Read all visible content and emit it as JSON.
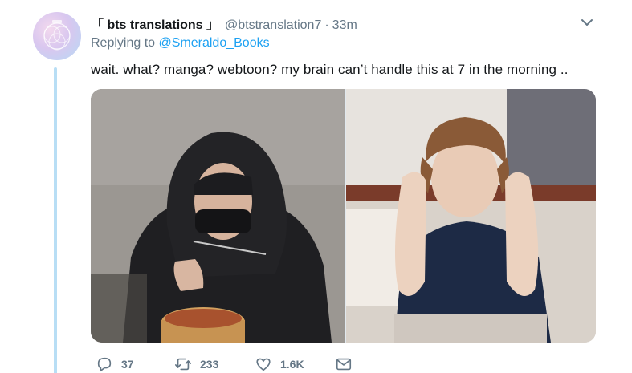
{
  "tweet": {
    "display_name": "「 bts translations 」",
    "handle": "@btstranslation7",
    "separator": "·",
    "time": "33m",
    "replying_prefix": "Replying to",
    "replying_to": "@Smeraldo_Books",
    "text": "wait. what? manga? webtoon? my brain can’t handle this at 7 in the morning ..",
    "media": [
      {
        "icon": "photo-person-hooded-eating"
      },
      {
        "icon": "photo-person-hands-on-head"
      }
    ],
    "actions": {
      "reply_count": "37",
      "retweet_count": "233",
      "like_count": "1.6K"
    }
  },
  "colors": {
    "link": "#1da1f2",
    "muted": "#657786",
    "thread_line": "#b8def5",
    "text": "#14171a"
  }
}
